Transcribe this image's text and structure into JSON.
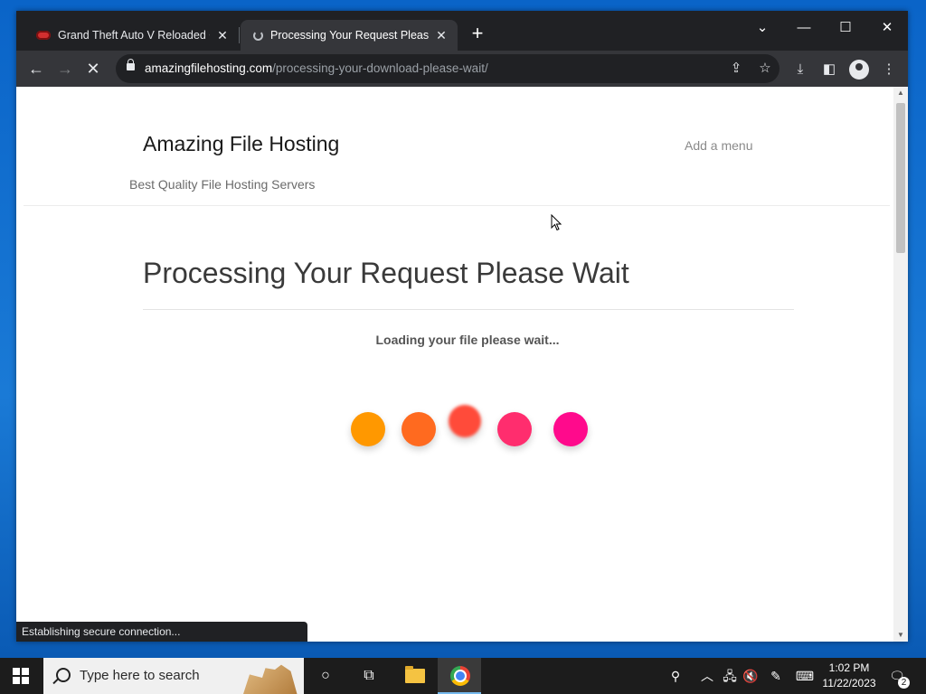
{
  "browser": {
    "tabs": [
      {
        "title": "Grand Theft Auto V Reloaded GTA",
        "active": false
      },
      {
        "title": "Processing Your Request Please Wait",
        "active": true
      }
    ],
    "url_host": "amazingfilehosting.com",
    "url_path": "/processing-your-download-please-wait/",
    "status_text": "Establishing secure connection..."
  },
  "site": {
    "title": "Amazing File Hosting",
    "menu_text": "Add a menu",
    "tagline": "Best Quality File Hosting Servers"
  },
  "page": {
    "heading": "Processing Your Request Please Wait",
    "loading_text": "Loading your file please wait..."
  },
  "loader_dot_colors": [
    "#ff9800",
    "#ff6a1f",
    "#ff4b3a",
    "#ff2d6e",
    "#ff0a8c"
  ],
  "taskbar": {
    "search_placeholder": "Type here to search",
    "time": "1:02 PM",
    "date": "11/22/2023",
    "notification_count": "2"
  },
  "colors": {
    "browser_frame": "#202124",
    "toolbar": "#35363a",
    "taskbar": "#1c1c1c",
    "accent": "#76b9ed"
  }
}
